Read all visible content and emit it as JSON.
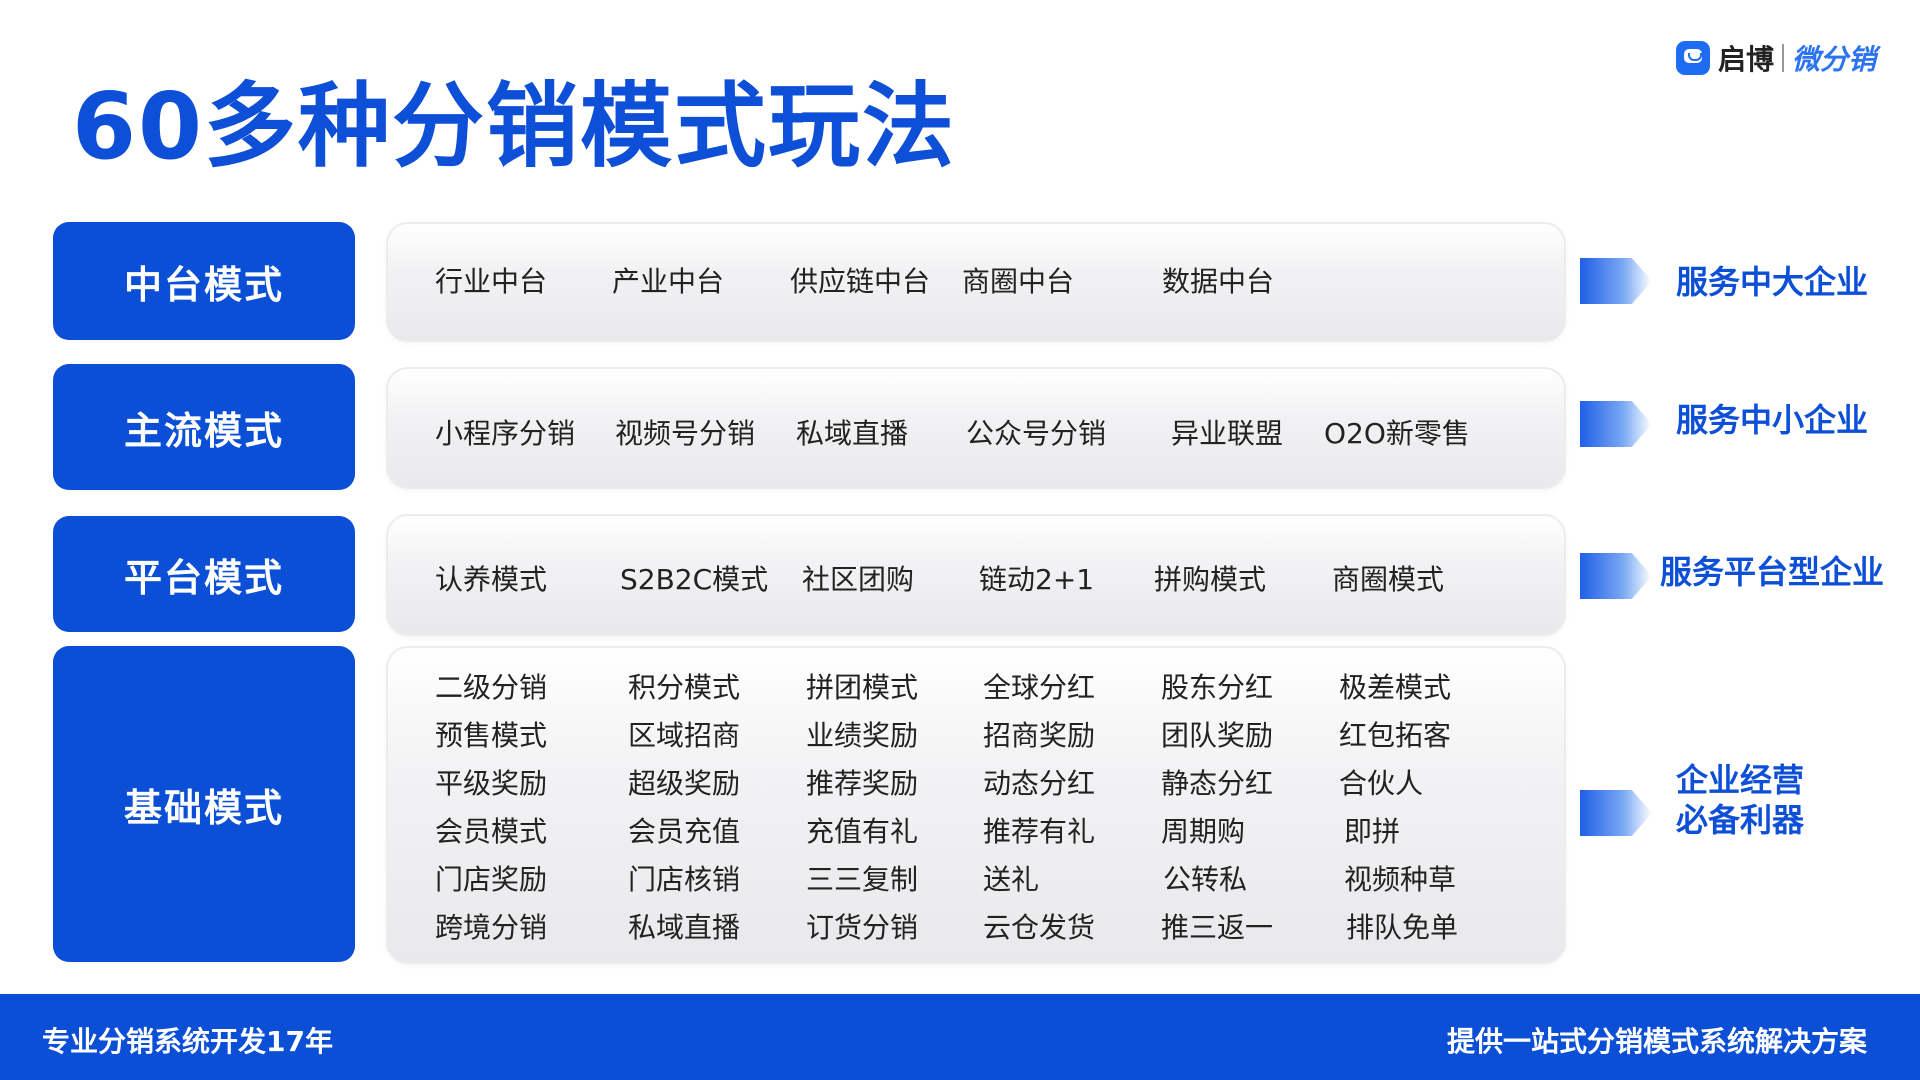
{
  "title": "60多种分销模式玩法",
  "logo": {
    "name": "启博",
    "product": "微分销"
  },
  "rows": [
    {
      "label": "中台模式",
      "items": [
        "行业中台",
        "产业中台",
        "供应链中台",
        "商圈中台",
        "数据中台"
      ],
      "target": "服务中大企业"
    },
    {
      "label": "主流模式",
      "items": [
        "小程序分销",
        "视频号分销",
        "私域直播",
        "公众号分销",
        "异业联盟",
        "O2O新零售"
      ],
      "target": "服务中小企业"
    },
    {
      "label": "平台模式",
      "items": [
        "认养模式",
        "S2B2C模式",
        "社区团购",
        "链动2+1",
        "拼购模式",
        "商圈模式"
      ],
      "target": "服务平台型企业"
    },
    {
      "label": "基础模式",
      "grid": [
        [
          "二级分销",
          "积分模式",
          "拼团模式",
          "全球分红",
          "股东分红",
          "极差模式"
        ],
        [
          "预售模式",
          "区域招商",
          "业绩奖励",
          "招商奖励",
          "团队奖励",
          "红包拓客"
        ],
        [
          "平级奖励",
          "超级奖励",
          "推荐奖励",
          "动态分红",
          "静态分红",
          "合伙人"
        ],
        [
          "会员模式",
          "会员充值",
          "充值有礼",
          "推荐有礼",
          "周期购",
          "即拼"
        ],
        [
          "门店奖励",
          "门店核销",
          "三三复制",
          "送礼",
          "公转私",
          "视频种草"
        ],
        [
          "跨境分销",
          "私域直播",
          "订货分销",
          "云仓发货",
          "推三返一",
          "排队免单"
        ]
      ],
      "target_lines": [
        "企业经营",
        "必备利器"
      ]
    }
  ],
  "footer": {
    "left": "专业分销系统开发17年",
    "right": "提供一站式分销模式系统解决方案"
  },
  "colors": {
    "primary": "#0a4fd6",
    "title": "#0d4fd6"
  }
}
